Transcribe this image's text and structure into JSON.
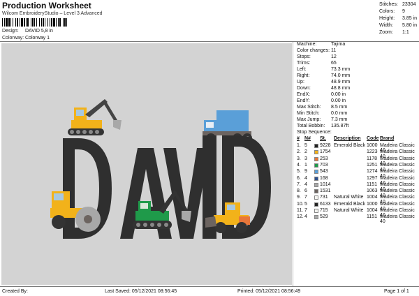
{
  "header": {
    "title": "Production Worksheet",
    "subtitle": "Wilcom EmbroideryStudio – Level 3 Advanced",
    "design_label": "Design:",
    "design_value": "DAVID 5,8 in",
    "colorway_label": "Colorway:",
    "colorway_value": "Colorway 1"
  },
  "top_stats": [
    {
      "label": "Stitches:",
      "value": "23304"
    },
    {
      "label": "Colors:",
      "value": "9"
    },
    {
      "label": "Height:",
      "value": "3.85 in"
    },
    {
      "label": "Width:",
      "value": "5.80 in"
    },
    {
      "label": "Zoom:",
      "value": "1:1"
    }
  ],
  "machine_stats": [
    {
      "label": "Machine:",
      "value": "Tajima"
    },
    {
      "label": "Color changes:",
      "value": "11"
    },
    {
      "label": "Stops:",
      "value": "12"
    },
    {
      "label": "Trims:",
      "value": "65"
    },
    {
      "label": "Left:",
      "value": "73.3 mm"
    },
    {
      "label": "Right:",
      "value": "74.0 mm"
    },
    {
      "label": "Up:",
      "value": "48.9 mm"
    },
    {
      "label": "Down:",
      "value": "48.8 mm"
    },
    {
      "label": "EndX:",
      "value": "0.00 in"
    },
    {
      "label": "EndY:",
      "value": "0.00 in"
    },
    {
      "label": "Max Stitch:",
      "value": "8.5 mm"
    },
    {
      "label": "Min Stitch:",
      "value": "0.0 mm"
    },
    {
      "label": "Max Jump:",
      "value": "7.3 mm"
    },
    {
      "label": "Total Bobbin:",
      "value": "135.87ft"
    }
  ],
  "sequence": {
    "title": "Stop Sequence:",
    "headers": {
      "num": "#",
      "n": "N#",
      "st": "St.",
      "desc": "Description",
      "code": "Code",
      "brand": "Brand"
    },
    "rows": [
      {
        "num": "1.",
        "n": "5",
        "color": "#222222",
        "st": "9228",
        "desc": "Emerald Black",
        "code": "1000",
        "brand": "Madeira Classic 40"
      },
      {
        "num": "2.",
        "n": "2",
        "color": "#f2b21a",
        "st": "1754",
        "desc": "",
        "code": "1223",
        "brand": "Madeira Classic 40"
      },
      {
        "num": "3.",
        "n": "3",
        "color": "#e8763a",
        "st": "253",
        "desc": "",
        "code": "1178",
        "brand": "Madeira Classic 40"
      },
      {
        "num": "4.",
        "n": "1",
        "color": "#1f9a4a",
        "st": "703",
        "desc": "",
        "code": "1251",
        "brand": "Madeira Classic 40"
      },
      {
        "num": "5.",
        "n": "9",
        "color": "#5a9fd8",
        "st": "543",
        "desc": "",
        "code": "1274",
        "brand": "Madeira Classic 40"
      },
      {
        "num": "6.",
        "n": "4",
        "color": "#2d4f8c",
        "st": "168",
        "desc": "",
        "code": "1297",
        "brand": "Madeira Classic 40"
      },
      {
        "num": "7.",
        "n": "4",
        "color": "#a8a8a8",
        "st": "1014",
        "desc": "",
        "code": "1151",
        "brand": "Madeira Classic 40"
      },
      {
        "num": "8.",
        "n": "6",
        "color": "#6c6460",
        "st": "1531",
        "desc": "",
        "code": "1063",
        "brand": "Madeira Classic 40"
      },
      {
        "num": "9.",
        "n": "7",
        "color": "#f4f4ef",
        "st": "731",
        "desc": "Natural White",
        "code": "1004",
        "brand": "Madeira Classic 40"
      },
      {
        "num": "10.",
        "n": "5",
        "color": "#222222",
        "st": "6133",
        "desc": "Emerald Black",
        "code": "1000",
        "brand": "Madeira Classic 40"
      },
      {
        "num": "11.",
        "n": "7",
        "color": "#f4f4ef",
        "st": "715",
        "desc": "Natural White",
        "code": "1004",
        "brand": "Madeira Classic 40"
      },
      {
        "num": "12.",
        "n": "4",
        "color": "#a8a8a8",
        "st": "529",
        "desc": "",
        "code": "1151",
        "brand": "Madeira Classic 40"
      }
    ]
  },
  "design_art": {
    "lettering": "DAVID",
    "letter_color": "#2f2f2f",
    "canvas_color": "#d3d3d3"
  },
  "footer": {
    "created_by": "Created By:",
    "last_saved": "Last Saved: 05/12/2021 08:56:45",
    "printed": "Printed: 05/12/2021 08:56:49",
    "page": "Page 1 of 1"
  }
}
